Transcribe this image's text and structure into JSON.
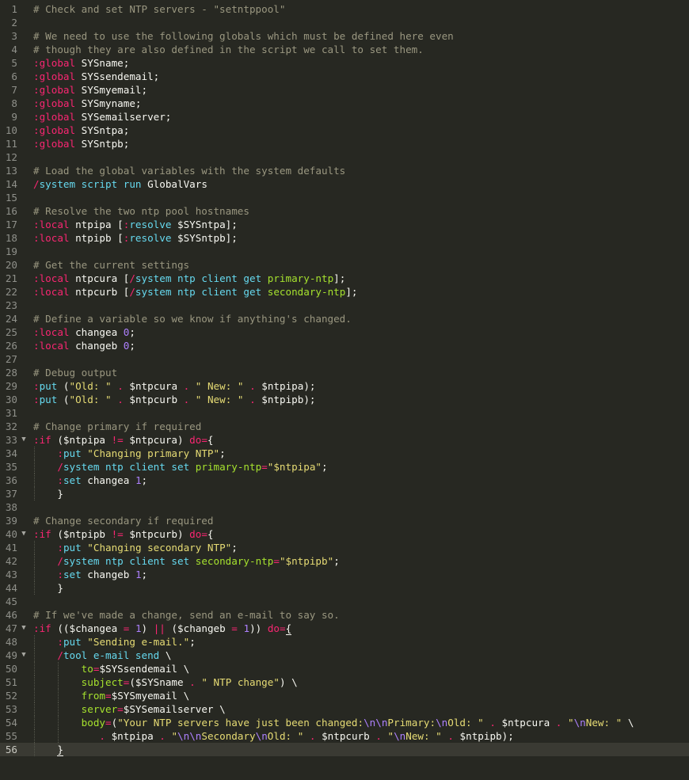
{
  "editor": {
    "current_line": 56,
    "lines": [
      {
        "n": 1,
        "indent": 0,
        "tokens": [
          [
            "c",
            "# Check and set NTP servers - \"setntppool\""
          ]
        ]
      },
      {
        "n": 2,
        "indent": 0,
        "tokens": []
      },
      {
        "n": 3,
        "indent": 0,
        "tokens": [
          [
            "c",
            "# We need to use the following globals which must be defined here even"
          ]
        ]
      },
      {
        "n": 4,
        "indent": 0,
        "tokens": [
          [
            "c",
            "# though they are also defined in the script we call to set them."
          ]
        ]
      },
      {
        "n": 5,
        "indent": 0,
        "tokens": [
          [
            "k",
            ":global"
          ],
          [
            "p",
            " SYSname;"
          ]
        ]
      },
      {
        "n": 6,
        "indent": 0,
        "tokens": [
          [
            "k",
            ":global"
          ],
          [
            "p",
            " SYSsendemail;"
          ]
        ]
      },
      {
        "n": 7,
        "indent": 0,
        "tokens": [
          [
            "k",
            ":global"
          ],
          [
            "p",
            " SYSmyemail;"
          ]
        ]
      },
      {
        "n": 8,
        "indent": 0,
        "tokens": [
          [
            "k",
            ":global"
          ],
          [
            "p",
            " SYSmyname;"
          ]
        ]
      },
      {
        "n": 9,
        "indent": 0,
        "tokens": [
          [
            "k",
            ":global"
          ],
          [
            "p",
            " SYSemailserver;"
          ]
        ]
      },
      {
        "n": 10,
        "indent": 0,
        "tokens": [
          [
            "k",
            ":global"
          ],
          [
            "p",
            " SYSntpa;"
          ]
        ]
      },
      {
        "n": 11,
        "indent": 0,
        "tokens": [
          [
            "k",
            ":global"
          ],
          [
            "p",
            " SYSntpb;"
          ]
        ]
      },
      {
        "n": 12,
        "indent": 0,
        "tokens": []
      },
      {
        "n": 13,
        "indent": 0,
        "tokens": [
          [
            "c",
            "# Load the global variables with the system defaults"
          ]
        ]
      },
      {
        "n": 14,
        "indent": 0,
        "tokens": [
          [
            "k",
            "/"
          ],
          [
            "f",
            "system script run"
          ],
          [
            "p",
            " GlobalVars"
          ]
        ]
      },
      {
        "n": 15,
        "indent": 0,
        "tokens": []
      },
      {
        "n": 16,
        "indent": 0,
        "tokens": [
          [
            "c",
            "# Resolve the two ntp pool hostnames"
          ]
        ]
      },
      {
        "n": 17,
        "indent": 0,
        "tokens": [
          [
            "k",
            ":local"
          ],
          [
            "p",
            " ntpipa ["
          ],
          [
            "k",
            ":"
          ],
          [
            "f",
            "resolve"
          ],
          [
            "p",
            " $SYSntpa];"
          ]
        ]
      },
      {
        "n": 18,
        "indent": 0,
        "tokens": [
          [
            "k",
            ":local"
          ],
          [
            "p",
            " ntpipb ["
          ],
          [
            "k",
            ":"
          ],
          [
            "f",
            "resolve"
          ],
          [
            "p",
            " $SYSntpb];"
          ]
        ]
      },
      {
        "n": 19,
        "indent": 0,
        "tokens": []
      },
      {
        "n": 20,
        "indent": 0,
        "tokens": [
          [
            "c",
            "# Get the current settings"
          ]
        ]
      },
      {
        "n": 21,
        "indent": 0,
        "tokens": [
          [
            "k",
            ":local"
          ],
          [
            "p",
            " ntpcura ["
          ],
          [
            "k",
            "/"
          ],
          [
            "f",
            "system ntp client get"
          ],
          [
            "p",
            " "
          ],
          [
            "g",
            "primary-ntp"
          ],
          [
            "p",
            "];"
          ]
        ]
      },
      {
        "n": 22,
        "indent": 0,
        "tokens": [
          [
            "k",
            ":local"
          ],
          [
            "p",
            " ntpcurb ["
          ],
          [
            "k",
            "/"
          ],
          [
            "f",
            "system ntp client get"
          ],
          [
            "p",
            " "
          ],
          [
            "g",
            "secondary-ntp"
          ],
          [
            "p",
            "];"
          ]
        ]
      },
      {
        "n": 23,
        "indent": 0,
        "tokens": []
      },
      {
        "n": 24,
        "indent": 0,
        "tokens": [
          [
            "c",
            "# Define a variable so we know if anything's changed."
          ]
        ]
      },
      {
        "n": 25,
        "indent": 0,
        "tokens": [
          [
            "k",
            ":local"
          ],
          [
            "p",
            " changea "
          ],
          [
            "n",
            "0"
          ],
          [
            "p",
            ";"
          ]
        ]
      },
      {
        "n": 26,
        "indent": 0,
        "tokens": [
          [
            "k",
            ":local"
          ],
          [
            "p",
            " changeb "
          ],
          [
            "n",
            "0"
          ],
          [
            "p",
            ";"
          ]
        ]
      },
      {
        "n": 27,
        "indent": 0,
        "tokens": []
      },
      {
        "n": 28,
        "indent": 0,
        "tokens": [
          [
            "c",
            "# Debug output"
          ]
        ]
      },
      {
        "n": 29,
        "indent": 0,
        "tokens": [
          [
            "k",
            ":"
          ],
          [
            "f",
            "put"
          ],
          [
            "p",
            " ("
          ],
          [
            "s",
            "\"Old: \""
          ],
          [
            "p",
            " "
          ],
          [
            "k",
            "."
          ],
          [
            "p",
            " $ntpcura "
          ],
          [
            "k",
            "."
          ],
          [
            "p",
            " "
          ],
          [
            "s",
            "\" New: \""
          ],
          [
            "p",
            " "
          ],
          [
            "k",
            "."
          ],
          [
            "p",
            " $ntpipa);"
          ]
        ]
      },
      {
        "n": 30,
        "indent": 0,
        "tokens": [
          [
            "k",
            ":"
          ],
          [
            "f",
            "put"
          ],
          [
            "p",
            " ("
          ],
          [
            "s",
            "\"Old: \""
          ],
          [
            "p",
            " "
          ],
          [
            "k",
            "."
          ],
          [
            "p",
            " $ntpcurb "
          ],
          [
            "k",
            "."
          ],
          [
            "p",
            " "
          ],
          [
            "s",
            "\" New: \""
          ],
          [
            "p",
            " "
          ],
          [
            "k",
            "."
          ],
          [
            "p",
            " $ntpipb);"
          ]
        ]
      },
      {
        "n": 31,
        "indent": 0,
        "tokens": []
      },
      {
        "n": 32,
        "indent": 0,
        "tokens": [
          [
            "c",
            "# Change primary if required"
          ]
        ]
      },
      {
        "n": 33,
        "indent": 0,
        "fold": true,
        "tokens": [
          [
            "k",
            ":"
          ],
          [
            "k",
            "if"
          ],
          [
            "p",
            " ($ntpipa "
          ],
          [
            "k",
            "!="
          ],
          [
            "p",
            " $ntpcura) "
          ],
          [
            "k",
            "do="
          ],
          [
            "p",
            "{"
          ]
        ]
      },
      {
        "n": 34,
        "indent": 1,
        "tokens": [
          [
            "k",
            ":"
          ],
          [
            "f",
            "put"
          ],
          [
            "p",
            " "
          ],
          [
            "s",
            "\"Changing primary NTP\""
          ],
          [
            "p",
            ";"
          ]
        ]
      },
      {
        "n": 35,
        "indent": 1,
        "tokens": [
          [
            "k",
            "/"
          ],
          [
            "f",
            "system ntp client set"
          ],
          [
            "p",
            " "
          ],
          [
            "g",
            "primary-ntp"
          ],
          [
            "k",
            "="
          ],
          [
            "s",
            "\"$ntpipa\""
          ],
          [
            "p",
            ";"
          ]
        ]
      },
      {
        "n": 36,
        "indent": 1,
        "tokens": [
          [
            "k",
            ":"
          ],
          [
            "f",
            "set"
          ],
          [
            "p",
            " changea "
          ],
          [
            "n",
            "1"
          ],
          [
            "p",
            ";"
          ]
        ]
      },
      {
        "n": 37,
        "indent": 1,
        "tokens": [
          [
            "p",
            "}"
          ]
        ]
      },
      {
        "n": 38,
        "indent": 0,
        "tokens": []
      },
      {
        "n": 39,
        "indent": 0,
        "tokens": [
          [
            "c",
            "# Change secondary if required"
          ]
        ]
      },
      {
        "n": 40,
        "indent": 0,
        "fold": true,
        "tokens": [
          [
            "k",
            ":"
          ],
          [
            "k",
            "if"
          ],
          [
            "p",
            " ($ntpipb "
          ],
          [
            "k",
            "!="
          ],
          [
            "p",
            " $ntpcurb) "
          ],
          [
            "k",
            "do="
          ],
          [
            "p",
            "{"
          ]
        ]
      },
      {
        "n": 41,
        "indent": 1,
        "tokens": [
          [
            "k",
            ":"
          ],
          [
            "f",
            "put"
          ],
          [
            "p",
            " "
          ],
          [
            "s",
            "\"Changing secondary NTP\""
          ],
          [
            "p",
            ";"
          ]
        ]
      },
      {
        "n": 42,
        "indent": 1,
        "tokens": [
          [
            "k",
            "/"
          ],
          [
            "f",
            "system ntp client set"
          ],
          [
            "p",
            " "
          ],
          [
            "g",
            "secondary-ntp"
          ],
          [
            "k",
            "="
          ],
          [
            "s",
            "\"$ntpipb\""
          ],
          [
            "p",
            ";"
          ]
        ]
      },
      {
        "n": 43,
        "indent": 1,
        "tokens": [
          [
            "k",
            ":"
          ],
          [
            "f",
            "set"
          ],
          [
            "p",
            " changeb "
          ],
          [
            "n",
            "1"
          ],
          [
            "p",
            ";"
          ]
        ]
      },
      {
        "n": 44,
        "indent": 1,
        "tokens": [
          [
            "p",
            "}"
          ]
        ]
      },
      {
        "n": 45,
        "indent": 0,
        "tokens": []
      },
      {
        "n": 46,
        "indent": 0,
        "tokens": [
          [
            "c",
            "# If we've made a change, send an e-mail to say so."
          ]
        ]
      },
      {
        "n": 47,
        "indent": 0,
        "fold": true,
        "tokens": [
          [
            "k",
            ":"
          ],
          [
            "k",
            "if"
          ],
          [
            "p",
            " (($changea "
          ],
          [
            "k",
            "="
          ],
          [
            "p",
            " "
          ],
          [
            "n",
            "1"
          ],
          [
            "p",
            ") "
          ],
          [
            "k",
            "||"
          ],
          [
            "p",
            " ($changeb "
          ],
          [
            "k",
            "="
          ],
          [
            "p",
            " "
          ],
          [
            "n",
            "1"
          ],
          [
            "p",
            ")) "
          ],
          [
            "k",
            "do="
          ],
          [
            "b",
            "{"
          ]
        ]
      },
      {
        "n": 48,
        "indent": 1,
        "tokens": [
          [
            "k",
            ":"
          ],
          [
            "f",
            "put"
          ],
          [
            "p",
            " "
          ],
          [
            "s",
            "\"Sending e-mail.\""
          ],
          [
            "p",
            ";"
          ]
        ]
      },
      {
        "n": 49,
        "indent": 1,
        "fold": true,
        "tokens": [
          [
            "k",
            "/"
          ],
          [
            "f",
            "tool e-mail send"
          ],
          [
            "p",
            " \\"
          ]
        ]
      },
      {
        "n": 50,
        "indent": 2,
        "tokens": [
          [
            "g",
            "to"
          ],
          [
            "k",
            "="
          ],
          [
            "p",
            "$SYSsendemail \\"
          ]
        ]
      },
      {
        "n": 51,
        "indent": 2,
        "tokens": [
          [
            "g",
            "subject"
          ],
          [
            "k",
            "="
          ],
          [
            "p",
            "($SYSname "
          ],
          [
            "k",
            "."
          ],
          [
            "p",
            " "
          ],
          [
            "s",
            "\" NTP change\""
          ],
          [
            "p",
            ") \\"
          ]
        ]
      },
      {
        "n": 52,
        "indent": 2,
        "tokens": [
          [
            "g",
            "from"
          ],
          [
            "k",
            "="
          ],
          [
            "p",
            "$SYSmyemail \\"
          ]
        ]
      },
      {
        "n": 53,
        "indent": 2,
        "tokens": [
          [
            "g",
            "server"
          ],
          [
            "k",
            "="
          ],
          [
            "p",
            "$SYSemailserver \\"
          ]
        ]
      },
      {
        "n": 54,
        "indent": 2,
        "tokens": [
          [
            "g",
            "body"
          ],
          [
            "k",
            "="
          ],
          [
            "p",
            "("
          ],
          [
            "s",
            "\"Your NTP servers have just been changed:"
          ],
          [
            "n",
            "\\n\\n"
          ],
          [
            "s",
            "Primary:"
          ],
          [
            "n",
            "\\n"
          ],
          [
            "s",
            "Old: \""
          ],
          [
            "p",
            " "
          ],
          [
            "k",
            "."
          ],
          [
            "p",
            " $ntpcura "
          ],
          [
            "k",
            "."
          ],
          [
            "p",
            " "
          ],
          [
            "s",
            "\""
          ],
          [
            "n",
            "\\n"
          ],
          [
            "s",
            "New: \""
          ],
          [
            "p",
            " \\"
          ]
        ]
      },
      {
        "n": 55,
        "indent": 2,
        "extra": "   ",
        "tokens": [
          [
            "k",
            "."
          ],
          [
            "p",
            " $ntpipa "
          ],
          [
            "k",
            "."
          ],
          [
            "p",
            " "
          ],
          [
            "s",
            "\""
          ],
          [
            "n",
            "\\n\\n"
          ],
          [
            "s",
            "Secondary"
          ],
          [
            "n",
            "\\n"
          ],
          [
            "s",
            "Old: \""
          ],
          [
            "p",
            " "
          ],
          [
            "k",
            "."
          ],
          [
            "p",
            " $ntpcurb "
          ],
          [
            "k",
            "."
          ],
          [
            "p",
            " "
          ],
          [
            "s",
            "\""
          ],
          [
            "n",
            "\\n"
          ],
          [
            "s",
            "New: \""
          ],
          [
            "p",
            " "
          ],
          [
            "k",
            "."
          ],
          [
            "p",
            " $ntpipb);"
          ]
        ]
      },
      {
        "n": 56,
        "indent": 1,
        "tokens": [
          [
            "b",
            "}"
          ]
        ]
      }
    ]
  }
}
